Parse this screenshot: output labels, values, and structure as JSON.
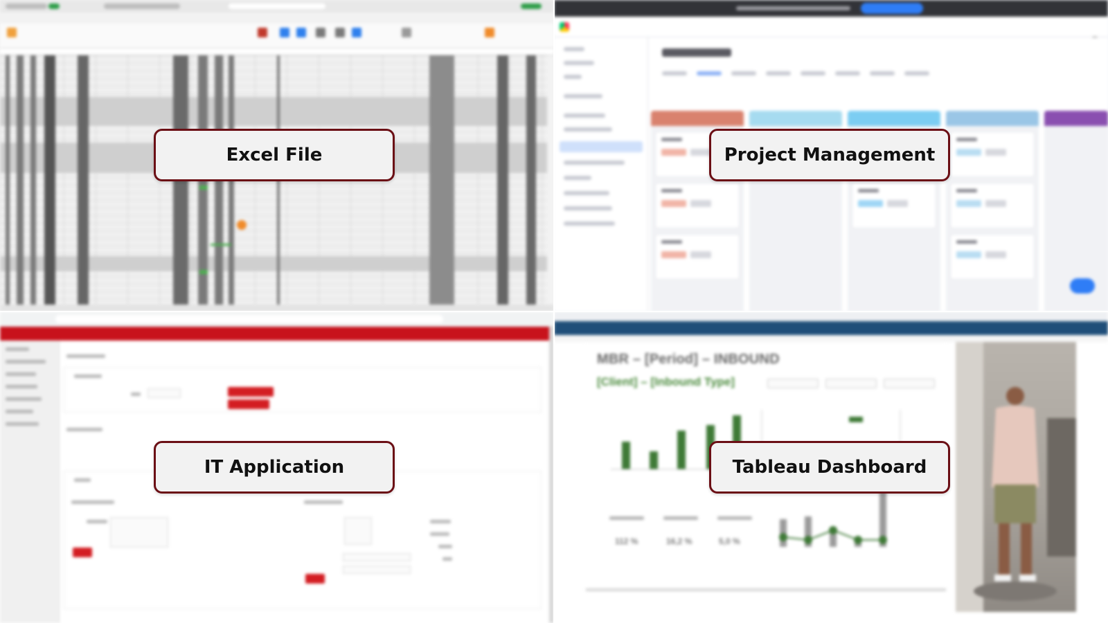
{
  "panels": {
    "excel": {
      "label": "Excel File"
    },
    "project_management": {
      "label": "Project Management"
    },
    "it_application": {
      "label": "IT Application"
    },
    "tableau": {
      "label": "Tableau Dashboard",
      "dashboard_title": "MBR – [Period] – INBOUND",
      "dashboard_subtitle": "[Client] – [Inbound Type]",
      "kpis": [
        "112 %",
        "16,2 %",
        "5,0 %"
      ]
    }
  },
  "colors": {
    "label_border": "#6b0f15",
    "label_background": "#f2f2f2",
    "it_brand_red": "#c8121c",
    "tableau_header": "#1f4e79",
    "tableau_green": "#4a8a3c",
    "monday_blue": "#2f7df6"
  }
}
